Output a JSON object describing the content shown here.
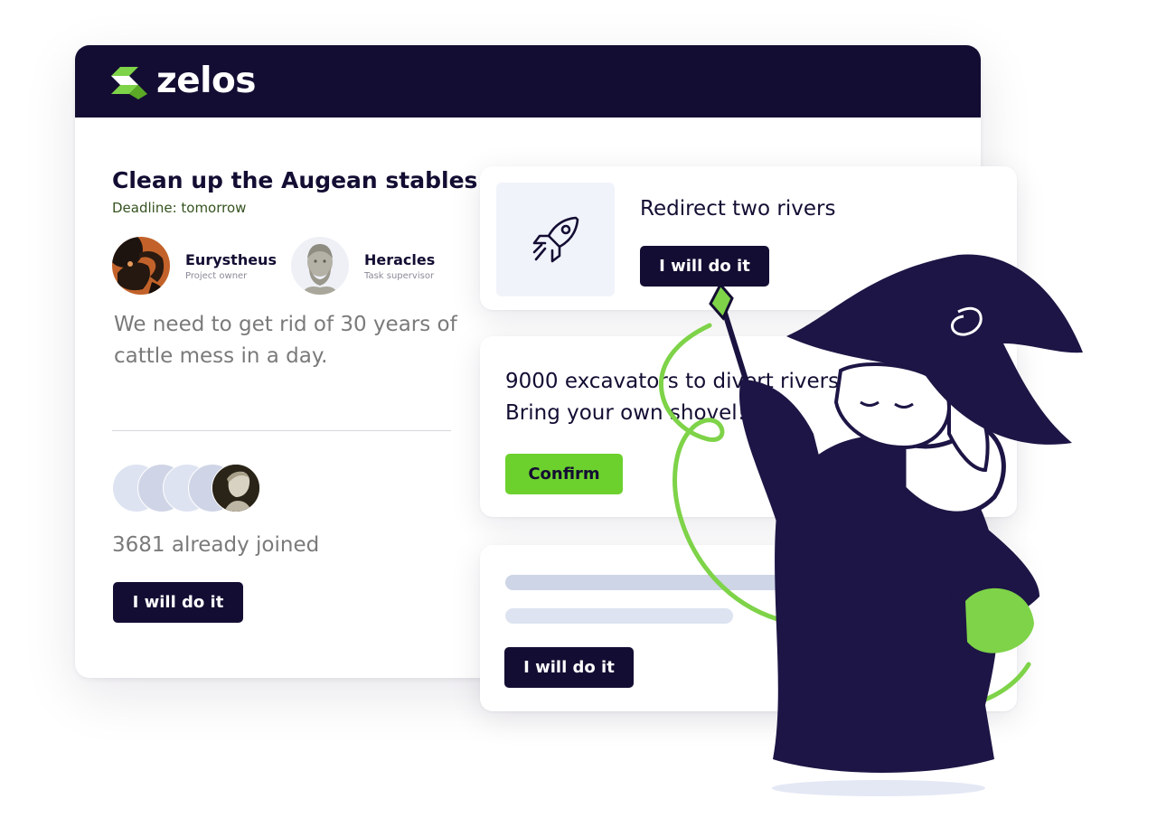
{
  "brand": {
    "name": "zelos",
    "header_color": "#140d33",
    "accent_color": "#6cd12d"
  },
  "task": {
    "title": "Clean up the Augean stables",
    "deadline": "Deadline: tomorrow",
    "people": [
      {
        "name": "Eurystheus",
        "role": "Project owner",
        "avatar": "portrait-avatar"
      },
      {
        "name": "Heracles",
        "role": "Task supervisor",
        "avatar": "statue-avatar"
      }
    ],
    "description": "We need to get rid of 30 years of cattle mess in a day.",
    "joined_text": "3681 already joined",
    "action_label": "I will do it"
  },
  "cards": [
    {
      "icon": "rocket-icon",
      "title": "Redirect two rivers",
      "action_label": "I will do it"
    },
    {
      "text_line1": "9000 excavators to divert rivers.",
      "text_line2": "Bring your own shovel!",
      "action_label": "Confirm"
    },
    {
      "action_label": "I will do it"
    }
  ],
  "illustration": {
    "subject": "wizard-illustration"
  }
}
